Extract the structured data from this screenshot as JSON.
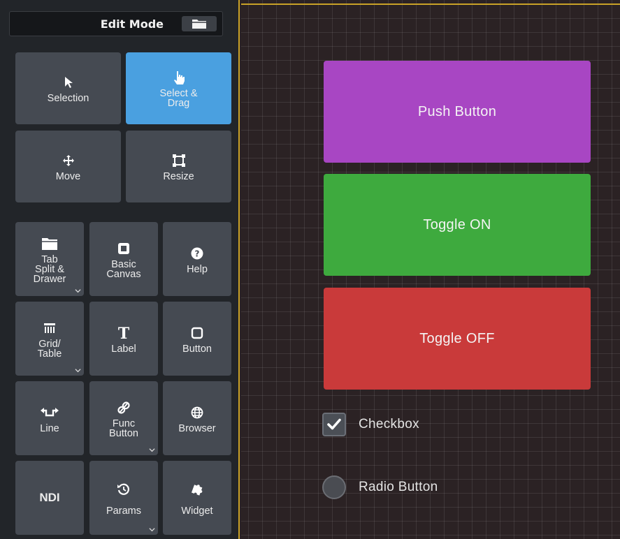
{
  "panel": {
    "title": "Edit Mode",
    "tools": [
      {
        "label": "Selection",
        "icon": "cursor-arrow-icon",
        "active": false
      },
      {
        "label": "Select &\nDrag",
        "icon": "hand-pointer-icon",
        "active": true
      },
      {
        "label": "Move",
        "icon": "move-arrows-icon",
        "active": false
      },
      {
        "label": "Resize",
        "icon": "resize-square-icon",
        "active": false
      }
    ],
    "widgets": [
      {
        "label": "Tab\nSplit &\nDrawer",
        "icon": "folder-icon",
        "has_menu": true
      },
      {
        "label": "Basic\nCanvas",
        "icon": "canvas-square-icon",
        "has_menu": false
      },
      {
        "label": "Help",
        "icon": "help-circle-icon",
        "has_menu": false
      },
      {
        "label": "Grid/\nTable",
        "icon": "table-columns-icon",
        "has_menu": true
      },
      {
        "label": "Label",
        "icon": "text-t-icon",
        "has_menu": false
      },
      {
        "label": "Button",
        "icon": "button-square-icon",
        "has_menu": false
      },
      {
        "label": "Line",
        "icon": "line-connector-icon",
        "has_menu": false
      },
      {
        "label": "Func\nButton",
        "icon": "link-function-icon",
        "has_menu": true
      },
      {
        "label": "Browser",
        "icon": "globe-icon",
        "has_menu": false
      },
      {
        "label": "NDI",
        "icon": "",
        "has_menu": false
      },
      {
        "label": "Params",
        "icon": "history-reset-icon",
        "has_menu": true
      },
      {
        "label": "Widget",
        "icon": "puzzle-piece-icon",
        "has_menu": false
      }
    ]
  },
  "canvas": {
    "push_button": {
      "label": "Push Button",
      "color": "#a846c3"
    },
    "toggle_on": {
      "label": "Toggle ON",
      "color": "#3eaa3e"
    },
    "toggle_off": {
      "label": "Toggle OFF",
      "color": "#c93a3a"
    },
    "checkbox": {
      "label": "Checkbox",
      "checked": true
    },
    "radio": {
      "label": "Radio Button",
      "selected": false
    }
  },
  "colors": {
    "accent": "#4aa0e0",
    "border": "#c9a227",
    "tile": "#454a52"
  }
}
